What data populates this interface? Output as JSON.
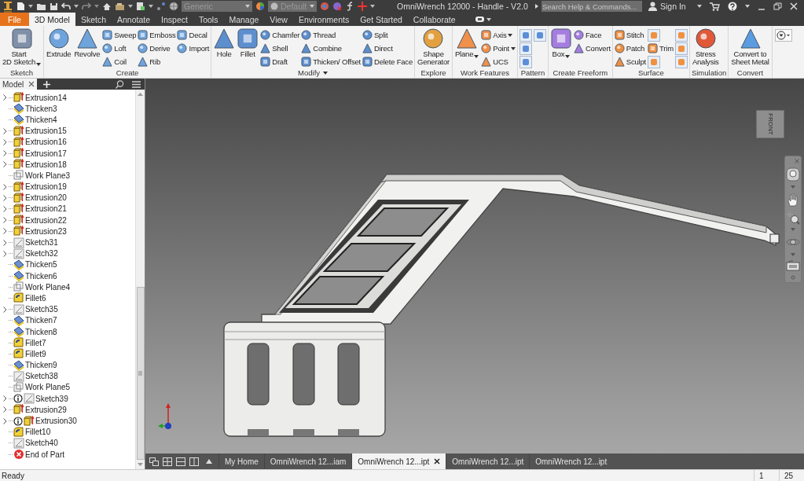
{
  "title_bar": {
    "material": "Generic",
    "appearance": "Default",
    "title": "OmniWrench 12000 - Handle - V2.0",
    "search": {
      "placeholder": "Search Help & Commands..."
    },
    "sign_in": "Sign In"
  },
  "menu_tabs": [
    {
      "label": "File",
      "kind": "file",
      "selected": false
    },
    {
      "label": "3D Model",
      "kind": "tab",
      "selected": true
    },
    {
      "label": "Sketch",
      "kind": "tab",
      "selected": false
    },
    {
      "label": "Annotate",
      "kind": "tab",
      "selected": false
    },
    {
      "label": "Inspect",
      "kind": "tab",
      "selected": false
    },
    {
      "label": "Tools",
      "kind": "tab",
      "selected": false
    },
    {
      "label": "Manage",
      "kind": "tab",
      "selected": false
    },
    {
      "label": "View",
      "kind": "tab",
      "selected": false
    },
    {
      "label": "Environments",
      "kind": "tab",
      "selected": false
    },
    {
      "label": "Get Started",
      "kind": "tab",
      "selected": false
    },
    {
      "label": "Collaborate",
      "kind": "tab",
      "selected": false
    }
  ],
  "ribbon": [
    {
      "label": "Sketch",
      "dropdown": false,
      "tools": [
        {
          "kind": "large",
          "label": "Start\n2D Sketch",
          "dropdown": true
        }
      ]
    },
    {
      "label": "Create",
      "dropdown": false,
      "tools": [
        {
          "kind": "large",
          "label": "Extrude",
          "dropdown": false
        },
        {
          "kind": "large",
          "label": "Revolve",
          "dropdown": false
        },
        {
          "kind": "column",
          "items": [
            {
              "kind": "text",
              "label": "Sweep",
              "dropdown": false
            },
            {
              "kind": "text",
              "label": "Loft",
              "dropdown": false
            },
            {
              "kind": "text",
              "label": "Coil",
              "dropdown": false
            }
          ]
        },
        {
          "kind": "column",
          "items": [
            {
              "kind": "text",
              "label": "Emboss",
              "dropdown": false
            },
            {
              "kind": "text",
              "label": "Derive",
              "dropdown": false
            },
            {
              "kind": "text",
              "label": "Rib",
              "dropdown": false
            }
          ]
        },
        {
          "kind": "column",
          "items": [
            {
              "kind": "text",
              "label": "Decal",
              "dropdown": false
            },
            {
              "kind": "text",
              "label": "Import",
              "dropdown": false
            }
          ]
        }
      ]
    },
    {
      "label": "Modify",
      "dropdown": true,
      "tools": [
        {
          "kind": "large",
          "label": "Hole",
          "dropdown": false
        },
        {
          "kind": "large",
          "label": "Fillet",
          "dropdown": false
        },
        {
          "kind": "column",
          "items": [
            {
              "kind": "text",
              "label": "Chamfer",
              "dropdown": false
            },
            {
              "kind": "text",
              "label": "Shell",
              "dropdown": false
            },
            {
              "kind": "text",
              "label": "Draft",
              "dropdown": false
            }
          ]
        },
        {
          "kind": "column",
          "items": [
            {
              "kind": "text",
              "label": "Thread",
              "dropdown": false
            },
            {
              "kind": "text",
              "label": "Combine",
              "dropdown": false
            },
            {
              "kind": "text",
              "label": "Thicken/ Offset",
              "dropdown": false
            }
          ]
        },
        {
          "kind": "column",
          "items": [
            {
              "kind": "text",
              "label": "Split",
              "dropdown": false
            },
            {
              "kind": "text",
              "label": "Direct",
              "dropdown": false
            },
            {
              "kind": "text",
              "label": "Delete Face",
              "dropdown": false
            }
          ]
        }
      ]
    },
    {
      "label": "Explore",
      "dropdown": false,
      "tools": [
        {
          "kind": "large",
          "label": "Shape\nGenerator",
          "dropdown": false
        }
      ]
    },
    {
      "label": "Work Features",
      "dropdown": false,
      "tools": [
        {
          "kind": "large",
          "label": "Plane",
          "dropdown": true
        },
        {
          "kind": "column",
          "items": [
            {
              "kind": "text",
              "label": "Axis",
              "dropdown": true
            },
            {
              "kind": "text",
              "label": "Point",
              "dropdown": true
            },
            {
              "kind": "text",
              "label": "UCS",
              "dropdown": false
            }
          ]
        }
      ]
    },
    {
      "label": "Pattern",
      "dropdown": false,
      "tools": [
        {
          "kind": "column",
          "items": [
            {
              "kind": "icon"
            },
            {
              "kind": "icon"
            },
            {
              "kind": "icon"
            }
          ]
        },
        {
          "kind": "column",
          "items": [
            {
              "kind": "icon"
            }
          ]
        }
      ]
    },
    {
      "label": "Create Freeform",
      "dropdown": false,
      "tools": [
        {
          "kind": "large",
          "label": "Box",
          "dropdown": true
        },
        {
          "kind": "column",
          "items": [
            {
              "kind": "text",
              "label": "Face",
              "dropdown": false
            },
            {
              "kind": "text",
              "label": "Convert",
              "dropdown": false
            }
          ]
        }
      ]
    },
    {
      "label": "Surface",
      "dropdown": false,
      "tools": [
        {
          "kind": "column",
          "items": [
            {
              "kind": "text",
              "label": "Stitch",
              "dropdown": false
            },
            {
              "kind": "text",
              "label": "Patch",
              "dropdown": false
            },
            {
              "kind": "text",
              "label": "Sculpt",
              "dropdown": false
            }
          ]
        },
        {
          "kind": "column",
          "items": [
            {
              "kind": "icon"
            },
            {
              "kind": "text",
              "label": "Trim",
              "dropdown": false
            },
            {
              "kind": "icon"
            }
          ]
        },
        {
          "kind": "column",
          "items": [
            {
              "kind": "icon"
            },
            {
              "kind": "icon"
            },
            {
              "kind": "icon"
            }
          ]
        }
      ]
    },
    {
      "label": "Simulation",
      "dropdown": false,
      "tools": [
        {
          "kind": "large",
          "label": "Stress\nAnalysis",
          "dropdown": false
        }
      ]
    },
    {
      "label": "Convert",
      "dropdown": false,
      "tools": [
        {
          "kind": "large",
          "label": "Convert to\nSheet Metal",
          "dropdown": false
        }
      ]
    }
  ],
  "browser": {
    "tab": "Model",
    "items": [
      {
        "label": "Extrusion14",
        "kind": "extrusion",
        "expandable": true,
        "note": false
      },
      {
        "label": "Thicken3",
        "kind": "thicken",
        "expandable": false,
        "note": false
      },
      {
        "label": "Thicken4",
        "kind": "thicken",
        "expandable": false,
        "note": false
      },
      {
        "label": "Extrusion15",
        "kind": "extrusion",
        "expandable": true,
        "note": false
      },
      {
        "label": "Extrusion16",
        "kind": "extrusion",
        "expandable": true,
        "note": false
      },
      {
        "label": "Extrusion17",
        "kind": "extrusion",
        "expandable": true,
        "note": false
      },
      {
        "label": "Extrusion18",
        "kind": "extrusion",
        "expandable": true,
        "note": false
      },
      {
        "label": "Work Plane3",
        "kind": "workplane",
        "expandable": false,
        "note": false
      },
      {
        "label": "Extrusion19",
        "kind": "extrusion",
        "expandable": true,
        "note": false
      },
      {
        "label": "Extrusion20",
        "kind": "extrusion",
        "expandable": true,
        "note": false
      },
      {
        "label": "Extrusion21",
        "kind": "extrusion",
        "expandable": true,
        "note": false
      },
      {
        "label": "Extrusion22",
        "kind": "extrusion",
        "expandable": true,
        "note": false
      },
      {
        "label": "Extrusion23",
        "kind": "extrusion",
        "expandable": true,
        "note": false
      },
      {
        "label": "Sketch31",
        "kind": "sketch",
        "expandable": true,
        "note": false
      },
      {
        "label": "Sketch32",
        "kind": "sketch",
        "expandable": true,
        "note": false
      },
      {
        "label": "Thicken5",
        "kind": "thicken",
        "expandable": false,
        "note": false
      },
      {
        "label": "Thicken6",
        "kind": "thicken",
        "expandable": false,
        "note": false
      },
      {
        "label": "Work Plane4",
        "kind": "workplane",
        "expandable": false,
        "note": false
      },
      {
        "label": "Fillet6",
        "kind": "fillet",
        "expandable": false,
        "note": false
      },
      {
        "label": "Sketch35",
        "kind": "sketch",
        "expandable": true,
        "note": false
      },
      {
        "label": "Thicken7",
        "kind": "thicken",
        "expandable": false,
        "note": false
      },
      {
        "label": "Thicken8",
        "kind": "thicken",
        "expandable": false,
        "note": false
      },
      {
        "label": "Fillet7",
        "kind": "fillet",
        "expandable": false,
        "note": false
      },
      {
        "label": "Fillet9",
        "kind": "fillet",
        "expandable": false,
        "note": false
      },
      {
        "label": "Thicken9",
        "kind": "thicken",
        "expandable": false,
        "note": false
      },
      {
        "label": "Sketch38",
        "kind": "sketch",
        "expandable": false,
        "note": false
      },
      {
        "label": "Work Plane5",
        "kind": "workplane",
        "expandable": false,
        "note": false
      },
      {
        "label": "Sketch39",
        "kind": "sketch",
        "expandable": true,
        "note": true
      },
      {
        "label": "Extrusion29",
        "kind": "extrusion",
        "expandable": true,
        "note": false
      },
      {
        "label": "Extrusion30",
        "kind": "extrusion",
        "expandable": true,
        "note": true
      },
      {
        "label": "Fillet10",
        "kind": "fillet",
        "expandable": false,
        "note": false
      },
      {
        "label": "Sketch40",
        "kind": "sketch",
        "expandable": false,
        "note": false
      },
      {
        "label": "End of Part",
        "kind": "end",
        "expandable": false,
        "note": false
      }
    ]
  },
  "view_cube": {
    "face": "FRONT"
  },
  "document_tabs": [
    {
      "label": "My Home",
      "selected": false
    },
    {
      "label": "OmniWrench 12...iam",
      "selected": false
    },
    {
      "label": "OmniWrench 12...ipt",
      "selected": true
    },
    {
      "label": "OmniWrench 12...ipt",
      "selected": false
    },
    {
      "label": "OmniWrench 12...ipt",
      "selected": false
    }
  ],
  "status_bar": {
    "message": "Ready",
    "fields": [
      "1",
      "25"
    ]
  }
}
